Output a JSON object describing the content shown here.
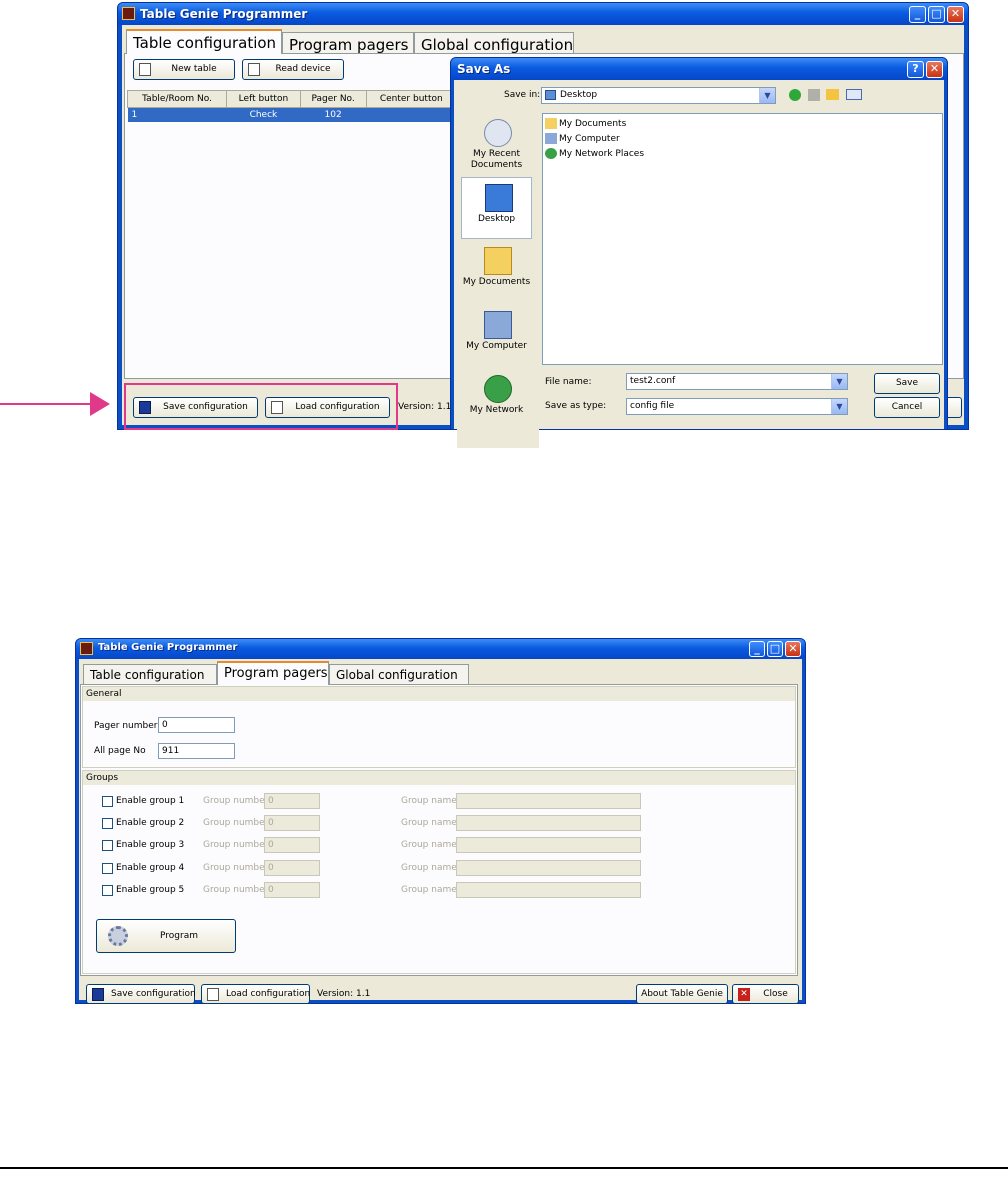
{
  "window1": {
    "title": "Table Genie Programmer",
    "tabs": [
      "Table configuration",
      "Program pagers",
      "Global configuration"
    ],
    "toolbar": {
      "new_table": "New table",
      "read_device": "Read device"
    },
    "table": {
      "headers": [
        "Table/Room No.",
        "Left button",
        "Pager No.",
        "Center button"
      ],
      "rows": [
        [
          "1",
          "Check",
          "102",
          ""
        ]
      ]
    },
    "footer": {
      "save_config": "Save configuration",
      "load_config": "Load configuration",
      "version": "Version: 1.1"
    }
  },
  "dialog": {
    "title": "Save As",
    "save_in_label": "Save in:",
    "save_in_value": "Desktop",
    "places": [
      "My Recent Documents",
      "Desktop",
      "My Documents",
      "My Computer",
      "My Network"
    ],
    "files": [
      "My Documents",
      "My Computer",
      "My Network Places"
    ],
    "file_name_label": "File name:",
    "file_name_value": "test2.conf",
    "save_type_label": "Save as type:",
    "save_type_value": "config file",
    "save_button": "Save",
    "cancel_button": "Cancel"
  },
  "window2": {
    "title": "Table Genie Programmer",
    "tabs": [
      "Table configuration",
      "Program pagers",
      "Global configuration"
    ],
    "general": {
      "title": "General",
      "pager_number_label": "Pager number",
      "pager_number_value": "0",
      "all_page_label": "All page No",
      "all_page_value": "911"
    },
    "groups": {
      "title": "Groups",
      "items": [
        {
          "label": "Enable group 1",
          "number_label": "Group number",
          "number_value": "0",
          "name_label": "Group name:"
        },
        {
          "label": "Enable group 2",
          "number_label": "Group number",
          "number_value": "0",
          "name_label": "Group name:"
        },
        {
          "label": "Enable group 3",
          "number_label": "Group number",
          "number_value": "0",
          "name_label": "Group name:"
        },
        {
          "label": "Enable group 4",
          "number_label": "Group number",
          "number_value": "0",
          "name_label": "Group name:"
        },
        {
          "label": "Enable group 5",
          "number_label": "Group number",
          "number_value": "0",
          "name_label": "Group name:"
        }
      ]
    },
    "program_button": "Program",
    "footer": {
      "save_config": "Save configuration",
      "load_config": "Load configuration",
      "version": "Version: 1.1",
      "about": "About Table Genie",
      "close": "Close"
    }
  },
  "colors": {
    "highlight": "#e0398a",
    "xp_blue": "#0a5be0",
    "selection": "#316ac5"
  }
}
